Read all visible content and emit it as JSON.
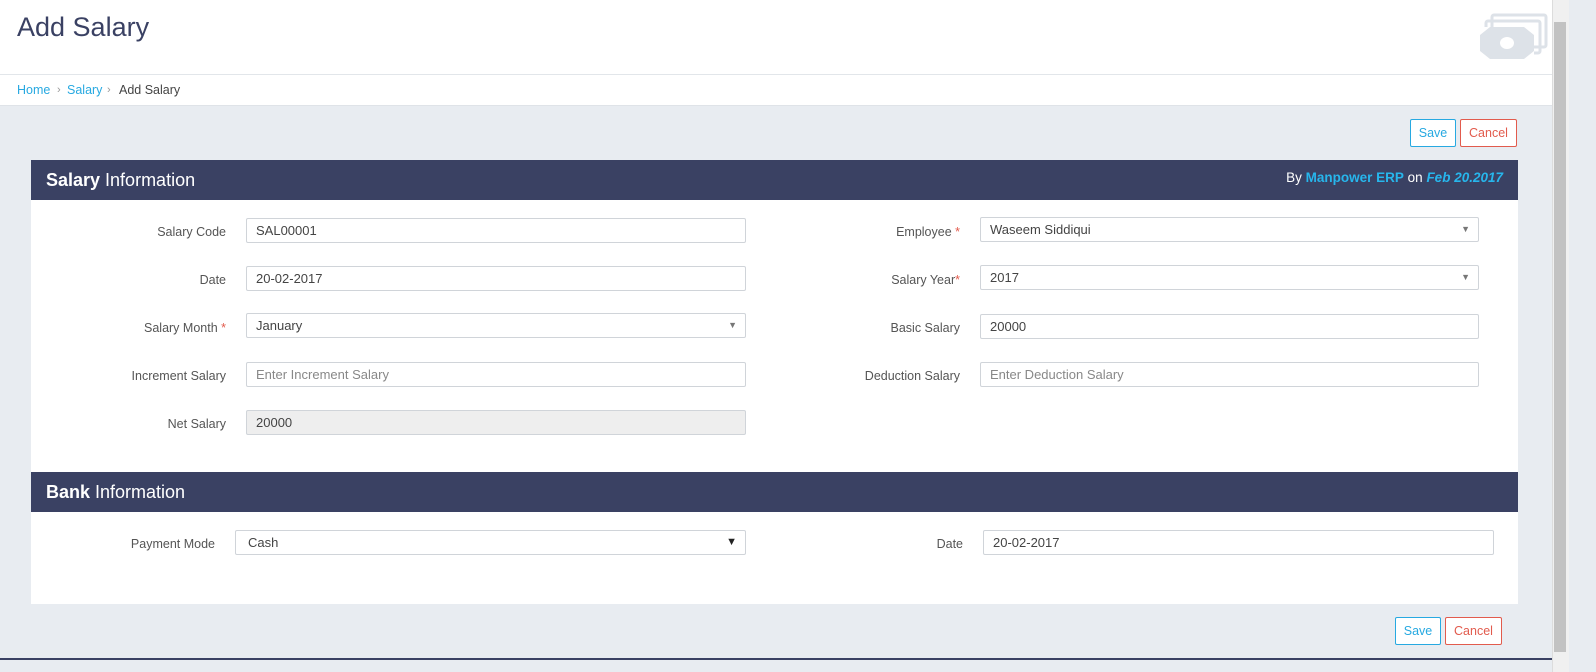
{
  "page": {
    "title": "Add Salary"
  },
  "breadcrumb": {
    "home": "Home",
    "salary": "Salary",
    "current": "Add Salary",
    "separator": "›"
  },
  "actions": {
    "save_label": "Save",
    "cancel_label": "Cancel"
  },
  "salary_panel": {
    "title_bold": "Salary",
    "title_rest": " Information",
    "meta_by": "By ",
    "meta_brand": "Manpower ERP",
    "meta_on": " on ",
    "meta_date": "Feb 20.2017",
    "fields": {
      "salary_code": {
        "label": "Salary Code",
        "value": "SAL00001"
      },
      "date": {
        "label": "Date",
        "value": "20-02-2017"
      },
      "salary_month": {
        "label": "Salary Month ",
        "required": "*",
        "value": "January"
      },
      "increment_salary": {
        "label": "Increment Salary",
        "placeholder": "Enter Increment Salary"
      },
      "net_salary": {
        "label": "Net Salary",
        "value": "20000"
      },
      "employee": {
        "label": "Employee ",
        "required": "*",
        "value": "Waseem Siddiqui"
      },
      "salary_year": {
        "label": "Salary Year",
        "required": "*",
        "value": "2017"
      },
      "basic_salary": {
        "label": "Basic Salary",
        "value": "20000"
      },
      "deduction_salary": {
        "label": "Deduction Salary",
        "placeholder": "Enter Deduction Salary"
      }
    }
  },
  "bank_panel": {
    "title_bold": "Bank",
    "title_rest": " Information",
    "fields": {
      "payment_mode": {
        "label": "Payment Mode",
        "value": "Cash"
      },
      "date": {
        "label": "Date",
        "value": "20-02-2017"
      }
    }
  },
  "icons": {
    "select_caret": "▼",
    "header_icon": "money-stack-icon"
  },
  "colors": {
    "primary_dark": "#3a4163",
    "accent_blue": "#27a9e1",
    "danger_red": "#e25b4d"
  }
}
